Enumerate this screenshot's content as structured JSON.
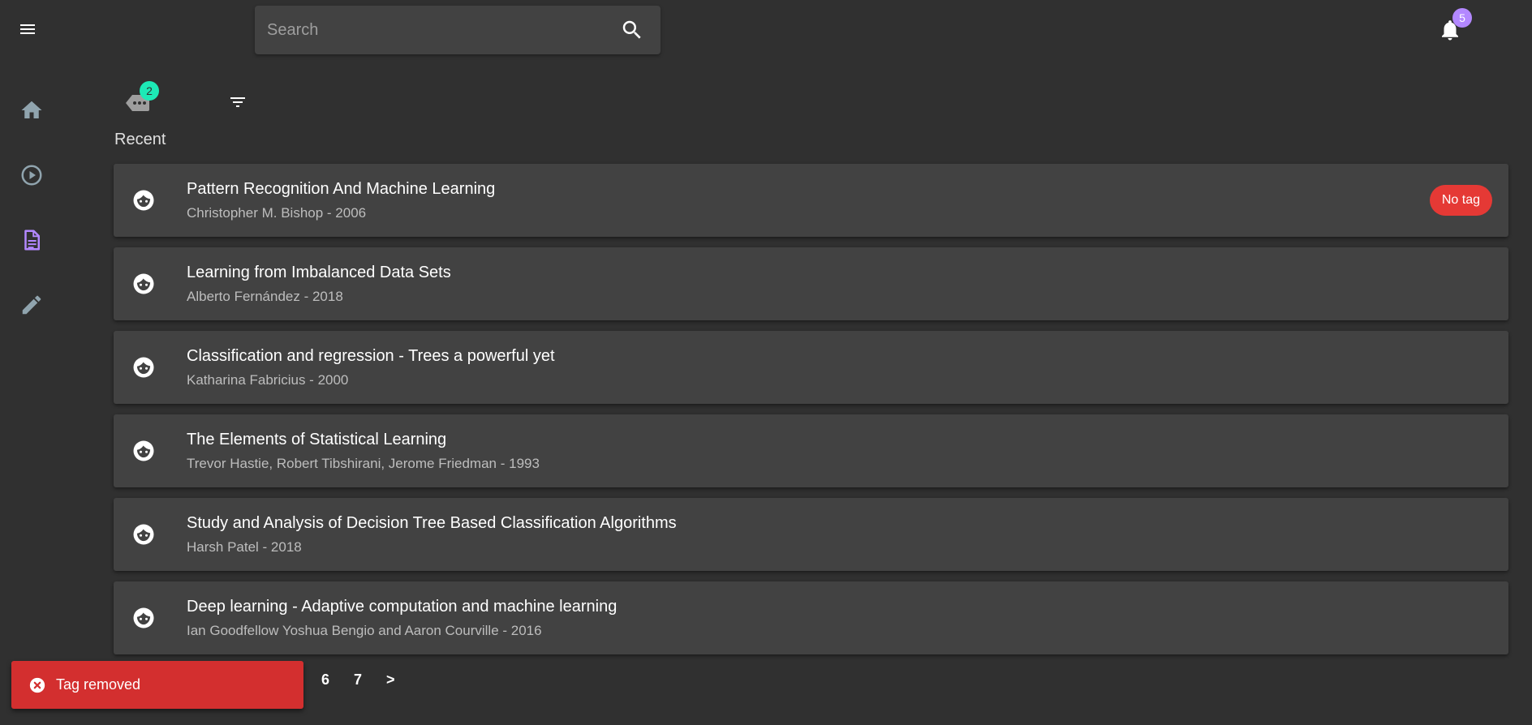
{
  "header": {
    "search_placeholder": "Search",
    "notification_count": "5",
    "icons": {
      "menu": "menu-icon",
      "search": "search-icon",
      "notifications": "bell-icon"
    }
  },
  "sidebar": {
    "items": [
      {
        "icon": "home-icon",
        "active": false
      },
      {
        "icon": "play-circle-icon",
        "active": false
      },
      {
        "icon": "document-icon",
        "active": true
      },
      {
        "icon": "pencil-icon",
        "active": false
      }
    ],
    "active_color": "#b388ff",
    "inactive_color": "#90a4ae"
  },
  "toolbar": {
    "tags_count": "2",
    "icons": {
      "tags": "tag-more-icon",
      "filter": "filter-icon"
    }
  },
  "section": {
    "title": "Recent"
  },
  "documents": [
    {
      "title": "Pattern Recognition And Machine Learning",
      "subtitle": "Christopher M. Bishop - 2006",
      "tag": "No tag"
    },
    {
      "title": "Learning from Imbalanced Data Sets",
      "subtitle": "Alberto Fernández - 2018"
    },
    {
      "title": "Classification and regression - Trees a powerful yet",
      "subtitle": "Katharina Fabricius - 2000"
    },
    {
      "title": "The Elements of Statistical Learning",
      "subtitle": "Trevor Hastie, Robert Tibshirani, Jerome Friedman - 1993"
    },
    {
      "title": "Study and Analysis of Decision Tree Based Classification Algorithms",
      "subtitle": "Harsh Patel - 2018"
    },
    {
      "title": "Deep learning - Adaptive computation and machine learning",
      "subtitle": "Ian Goodfellow Yoshua Bengio and Aaron Courville - 2016"
    }
  ],
  "pagination": {
    "pages": [
      "6",
      "7"
    ],
    "next": ">"
  },
  "snackbar": {
    "message": "Tag removed",
    "icon": "close-circle-icon"
  },
  "colors": {
    "background": "#303030",
    "surface": "#424242",
    "tag_chip": "#e53935",
    "snackbar": "#d32f2f",
    "notification_badge": "#b388ff",
    "tags_badge": "#1de9b6"
  }
}
